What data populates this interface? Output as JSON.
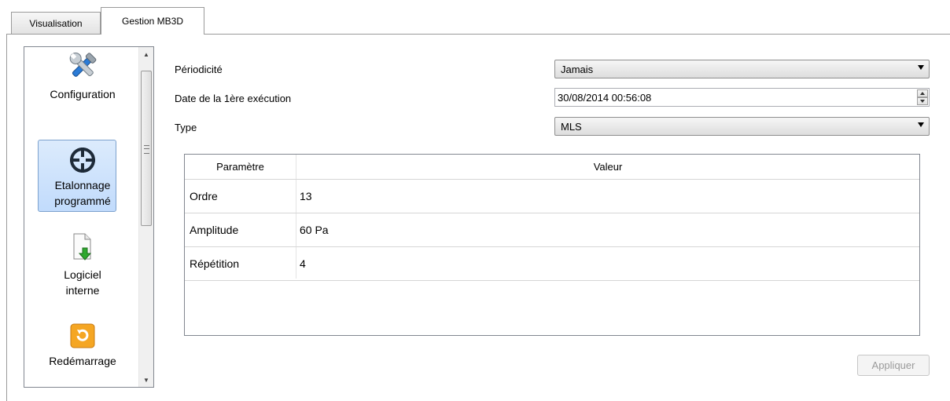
{
  "tabs": [
    {
      "label": "Visualisation"
    },
    {
      "label": "Gestion MB3D"
    }
  ],
  "sidebar": {
    "items": [
      {
        "label_lines": [
          "Configuration"
        ],
        "icon": "tools-icon"
      },
      {
        "label_lines": [
          "Etalonnage",
          "programmé"
        ],
        "icon": "crosshair-icon",
        "selected": true
      },
      {
        "label_lines": [
          "Logiciel",
          "interne"
        ],
        "icon": "file-download-icon"
      },
      {
        "label_lines": [
          "Redémarrage"
        ],
        "icon": "restart-icon"
      }
    ]
  },
  "form": {
    "periodicite_label": "Périodicité",
    "periodicite_value": "Jamais",
    "date_label": "Date de la 1ère exécution",
    "date_value": "30/08/2014 00:56:08",
    "type_label": "Type",
    "type_value": "MLS"
  },
  "table": {
    "headers": [
      "Paramètre",
      "Valeur"
    ],
    "rows": [
      {
        "param": "Ordre",
        "value": "13"
      },
      {
        "param": "Amplitude",
        "value": "60 Pa"
      },
      {
        "param": "Répétition",
        "value": "4"
      }
    ]
  },
  "apply_label": "Appliquer",
  "colors": {
    "selection": "#c1dbfc",
    "restart_icon": "#f5a623",
    "download_arrow": "#2fa82f"
  }
}
